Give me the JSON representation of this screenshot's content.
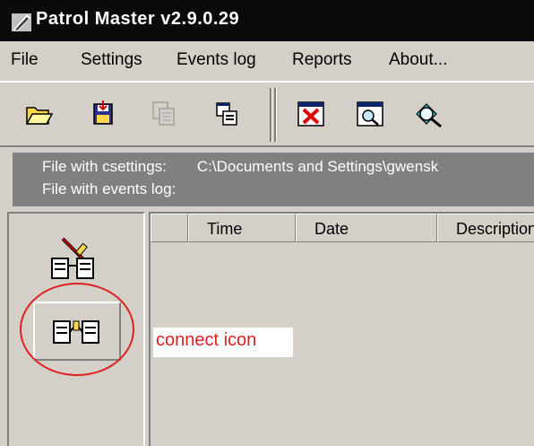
{
  "window": {
    "title": "Patrol Master v2.9.0.29",
    "app_icon": "patrol-master-app-icon"
  },
  "menu": {
    "items": [
      "File",
      "Settings",
      "Events log",
      "Reports",
      "About..."
    ]
  },
  "toolbar": {
    "buttons": [
      {
        "name": "open-folder-icon"
      },
      {
        "name": "save-disk-icon"
      },
      {
        "name": "disabled-copy-icon"
      },
      {
        "name": "print-window-icon"
      },
      {
        "name": "delete-window-icon"
      },
      {
        "name": "search-window-icon"
      },
      {
        "name": "magnifier-icon"
      }
    ]
  },
  "info": {
    "settings_label": "File with csettings:",
    "settings_path": "C:\\Documents and Settings\\gwensk",
    "events_label": "File with events log:"
  },
  "left_panel": {
    "buttons": [
      {
        "name": "disconnect-icon"
      },
      {
        "name": "connect-icon"
      }
    ]
  },
  "table": {
    "columns": [
      "",
      "Time",
      "Date",
      "Description"
    ]
  },
  "annotation": {
    "label": "connect icon",
    "color": "#e02020"
  }
}
